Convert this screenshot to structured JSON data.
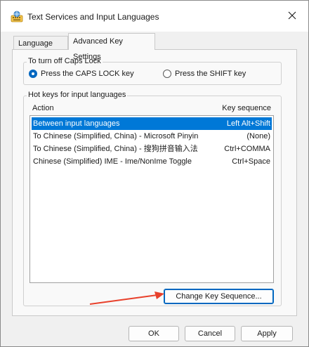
{
  "window": {
    "title": "Text Services and Input Languages",
    "icon": "keyboard-globe-icon"
  },
  "tabs": [
    {
      "label": "Language Bar",
      "active": false
    },
    {
      "label": "Advanced Key Settings",
      "active": true
    }
  ],
  "caps_lock": {
    "group_label": "To turn off Caps Lock",
    "options": [
      {
        "label": "Press the CAPS LOCK key",
        "checked": true
      },
      {
        "label": "Press the SHIFT key",
        "checked": false
      }
    ]
  },
  "hotkeys": {
    "group_label": "Hot keys for input languages",
    "columns": {
      "action": "Action",
      "sequence": "Key sequence"
    },
    "rows": [
      {
        "action": "Between input languages",
        "sequence": "Left Alt+Shift",
        "selected": true
      },
      {
        "action": "To Chinese (Simplified, China) - Microsoft Pinyin",
        "sequence": "(None)",
        "selected": false
      },
      {
        "action": "To Chinese (Simplified, China) - 搜狗拼音输入法",
        "sequence": "Ctrl+COMMA",
        "selected": false
      },
      {
        "action": "Chinese (Simplified) IME - Ime/NonIme Toggle",
        "sequence": "Ctrl+Space",
        "selected": false
      }
    ],
    "change_button": "Change Key Sequence..."
  },
  "footer": {
    "ok": "OK",
    "cancel": "Cancel",
    "apply": "Apply"
  },
  "colors": {
    "accent": "#0067c0",
    "selection": "#0078d7",
    "annotation_arrow": "#e8412c"
  }
}
